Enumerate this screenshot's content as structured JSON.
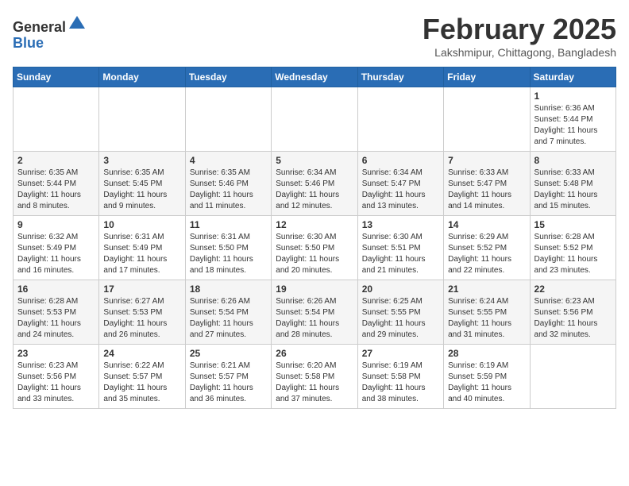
{
  "header": {
    "logo_general": "General",
    "logo_blue": "Blue",
    "month_title": "February 2025",
    "location": "Lakshmipur, Chittagong, Bangladesh"
  },
  "calendar": {
    "weekdays": [
      "Sunday",
      "Monday",
      "Tuesday",
      "Wednesday",
      "Thursday",
      "Friday",
      "Saturday"
    ],
    "weeks": [
      [
        {
          "day": "",
          "info": ""
        },
        {
          "day": "",
          "info": ""
        },
        {
          "day": "",
          "info": ""
        },
        {
          "day": "",
          "info": ""
        },
        {
          "day": "",
          "info": ""
        },
        {
          "day": "",
          "info": ""
        },
        {
          "day": "1",
          "info": "Sunrise: 6:36 AM\nSunset: 5:44 PM\nDaylight: 11 hours and 7 minutes."
        }
      ],
      [
        {
          "day": "2",
          "info": "Sunrise: 6:35 AM\nSunset: 5:44 PM\nDaylight: 11 hours and 8 minutes."
        },
        {
          "day": "3",
          "info": "Sunrise: 6:35 AM\nSunset: 5:45 PM\nDaylight: 11 hours and 9 minutes."
        },
        {
          "day": "4",
          "info": "Sunrise: 6:35 AM\nSunset: 5:46 PM\nDaylight: 11 hours and 11 minutes."
        },
        {
          "day": "5",
          "info": "Sunrise: 6:34 AM\nSunset: 5:46 PM\nDaylight: 11 hours and 12 minutes."
        },
        {
          "day": "6",
          "info": "Sunrise: 6:34 AM\nSunset: 5:47 PM\nDaylight: 11 hours and 13 minutes."
        },
        {
          "day": "7",
          "info": "Sunrise: 6:33 AM\nSunset: 5:47 PM\nDaylight: 11 hours and 14 minutes."
        },
        {
          "day": "8",
          "info": "Sunrise: 6:33 AM\nSunset: 5:48 PM\nDaylight: 11 hours and 15 minutes."
        }
      ],
      [
        {
          "day": "9",
          "info": "Sunrise: 6:32 AM\nSunset: 5:49 PM\nDaylight: 11 hours and 16 minutes."
        },
        {
          "day": "10",
          "info": "Sunrise: 6:31 AM\nSunset: 5:49 PM\nDaylight: 11 hours and 17 minutes."
        },
        {
          "day": "11",
          "info": "Sunrise: 6:31 AM\nSunset: 5:50 PM\nDaylight: 11 hours and 18 minutes."
        },
        {
          "day": "12",
          "info": "Sunrise: 6:30 AM\nSunset: 5:50 PM\nDaylight: 11 hours and 20 minutes."
        },
        {
          "day": "13",
          "info": "Sunrise: 6:30 AM\nSunset: 5:51 PM\nDaylight: 11 hours and 21 minutes."
        },
        {
          "day": "14",
          "info": "Sunrise: 6:29 AM\nSunset: 5:52 PM\nDaylight: 11 hours and 22 minutes."
        },
        {
          "day": "15",
          "info": "Sunrise: 6:28 AM\nSunset: 5:52 PM\nDaylight: 11 hours and 23 minutes."
        }
      ],
      [
        {
          "day": "16",
          "info": "Sunrise: 6:28 AM\nSunset: 5:53 PM\nDaylight: 11 hours and 24 minutes."
        },
        {
          "day": "17",
          "info": "Sunrise: 6:27 AM\nSunset: 5:53 PM\nDaylight: 11 hours and 26 minutes."
        },
        {
          "day": "18",
          "info": "Sunrise: 6:26 AM\nSunset: 5:54 PM\nDaylight: 11 hours and 27 minutes."
        },
        {
          "day": "19",
          "info": "Sunrise: 6:26 AM\nSunset: 5:54 PM\nDaylight: 11 hours and 28 minutes."
        },
        {
          "day": "20",
          "info": "Sunrise: 6:25 AM\nSunset: 5:55 PM\nDaylight: 11 hours and 29 minutes."
        },
        {
          "day": "21",
          "info": "Sunrise: 6:24 AM\nSunset: 5:55 PM\nDaylight: 11 hours and 31 minutes."
        },
        {
          "day": "22",
          "info": "Sunrise: 6:23 AM\nSunset: 5:56 PM\nDaylight: 11 hours and 32 minutes."
        }
      ],
      [
        {
          "day": "23",
          "info": "Sunrise: 6:23 AM\nSunset: 5:56 PM\nDaylight: 11 hours and 33 minutes."
        },
        {
          "day": "24",
          "info": "Sunrise: 6:22 AM\nSunset: 5:57 PM\nDaylight: 11 hours and 35 minutes."
        },
        {
          "day": "25",
          "info": "Sunrise: 6:21 AM\nSunset: 5:57 PM\nDaylight: 11 hours and 36 minutes."
        },
        {
          "day": "26",
          "info": "Sunrise: 6:20 AM\nSunset: 5:58 PM\nDaylight: 11 hours and 37 minutes."
        },
        {
          "day": "27",
          "info": "Sunrise: 6:19 AM\nSunset: 5:58 PM\nDaylight: 11 hours and 38 minutes."
        },
        {
          "day": "28",
          "info": "Sunrise: 6:19 AM\nSunset: 5:59 PM\nDaylight: 11 hours and 40 minutes."
        },
        {
          "day": "",
          "info": ""
        }
      ]
    ]
  }
}
